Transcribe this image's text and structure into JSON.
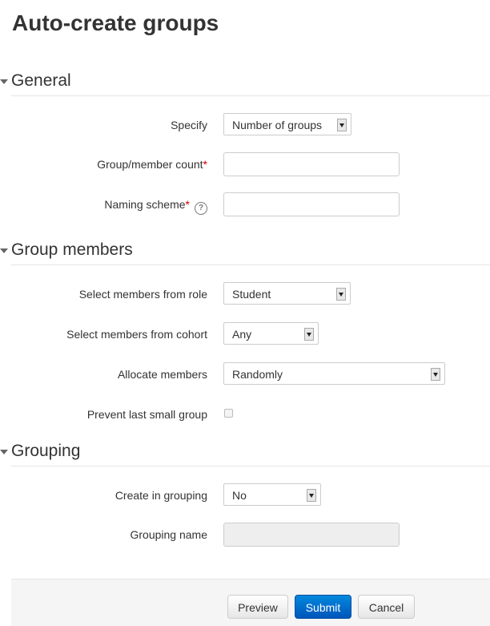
{
  "page_title": "Auto-create groups",
  "sections": {
    "general": {
      "legend": "General",
      "specify": {
        "label": "Specify",
        "value": "Number of groups"
      },
      "count": {
        "label": "Group/member count",
        "required_mark": "*",
        "value": ""
      },
      "naming": {
        "label": "Naming scheme",
        "required_mark": "*",
        "help_glyph": "?",
        "value": ""
      }
    },
    "members": {
      "legend": "Group members",
      "role": {
        "label": "Select members from role",
        "value": "Student"
      },
      "cohort": {
        "label": "Select members from cohort",
        "value": "Any"
      },
      "allocate": {
        "label": "Allocate members",
        "value": "Randomly"
      },
      "prevent": {
        "label": "Prevent last small group",
        "checked": false
      }
    },
    "grouping": {
      "legend": "Grouping",
      "create": {
        "label": "Create in grouping",
        "value": "No"
      },
      "name": {
        "label": "Grouping name",
        "value": ""
      }
    }
  },
  "buttons": {
    "preview": "Preview",
    "submit": "Submit",
    "cancel": "Cancel"
  },
  "colors": {
    "required": "#cc0000",
    "primary_button": "#0070d0",
    "footer_bg": "#f5f5f5"
  },
  "icons": [
    "collapse-triangle-icon",
    "help-icon",
    "dropdown-arrow-icon"
  ]
}
